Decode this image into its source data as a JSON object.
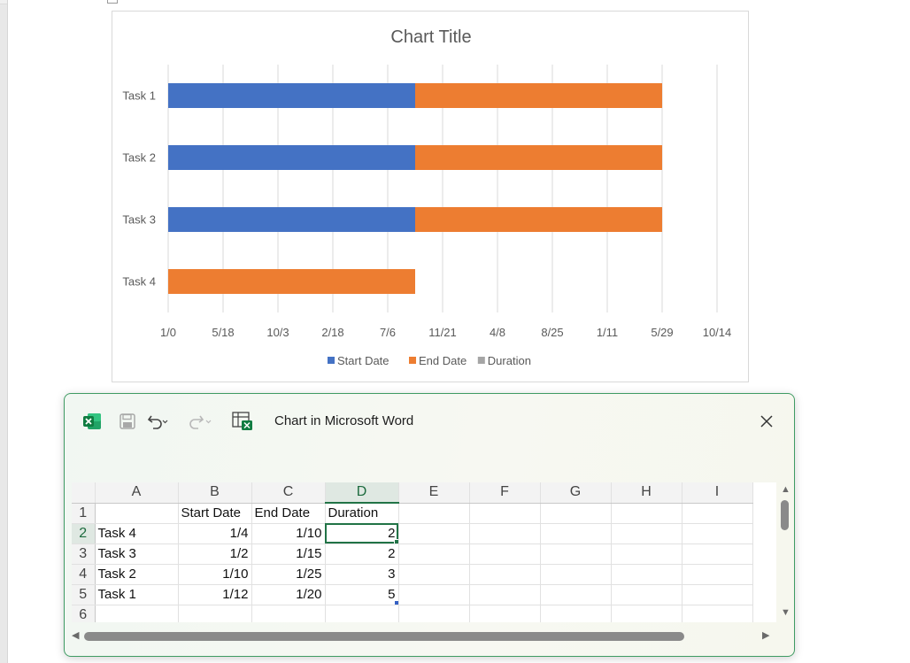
{
  "chart_data": {
    "type": "bar",
    "orientation": "horizontal",
    "stacked": true,
    "title": "Chart Title",
    "categories": [
      "Task 1",
      "Task 2",
      "Task 3",
      "Task 4"
    ],
    "series": [
      {
        "name": "Start Date",
        "color": "#4472c4",
        "values": [
          1,
          1,
          1,
          0
        ]
      },
      {
        "name": "End Date",
        "color": "#ed7d31",
        "values": [
          1,
          1,
          1,
          1
        ]
      },
      {
        "name": "Duration",
        "color": "#a5a5a5",
        "values": [
          0,
          0,
          0,
          0
        ]
      }
    ],
    "x_tick_labels": [
      "1/0",
      "5/18",
      "10/3",
      "2/18",
      "7/6",
      "11/21",
      "4/8",
      "8/25",
      "1/11",
      "5/29",
      "10/14"
    ],
    "xlim": [
      0,
      2
    ],
    "grid": true,
    "legend_position": "bottom"
  },
  "window": {
    "title": "Chart in Microsoft Word",
    "icons": [
      "excel-icon",
      "save-icon",
      "undo-icon",
      "redo-icon",
      "edit-data-in-excel-icon",
      "close-icon"
    ]
  },
  "sheet": {
    "columns": [
      "A",
      "B",
      "C",
      "D",
      "E",
      "F",
      "G",
      "H",
      "I"
    ],
    "active_column": "D",
    "active_row": "2",
    "rows": [
      {
        "num": "1",
        "cells": [
          "",
          "Start Date",
          "End Date",
          "Duration",
          "",
          "",
          "",
          "",
          ""
        ]
      },
      {
        "num": "2",
        "cells": [
          "Task 4",
          "1/4",
          "1/10",
          "2",
          "",
          "",
          "",
          "",
          ""
        ]
      },
      {
        "num": "3",
        "cells": [
          "Task 3",
          "1/2",
          "1/15",
          "2",
          "",
          "",
          "",
          "",
          ""
        ]
      },
      {
        "num": "4",
        "cells": [
          "Task 2",
          "1/10",
          "1/25",
          "3",
          "",
          "",
          "",
          "",
          ""
        ]
      },
      {
        "num": "5",
        "cells": [
          "Task 1",
          "1/12",
          "1/20",
          "5",
          "",
          "",
          "",
          "",
          ""
        ]
      },
      {
        "num": "6",
        "cells": [
          "",
          "",
          "",
          "",
          "",
          "",
          "",
          "",
          ""
        ]
      }
    ]
  },
  "colors": {
    "accent": "#217346",
    "window_border": "#3f9b63"
  }
}
